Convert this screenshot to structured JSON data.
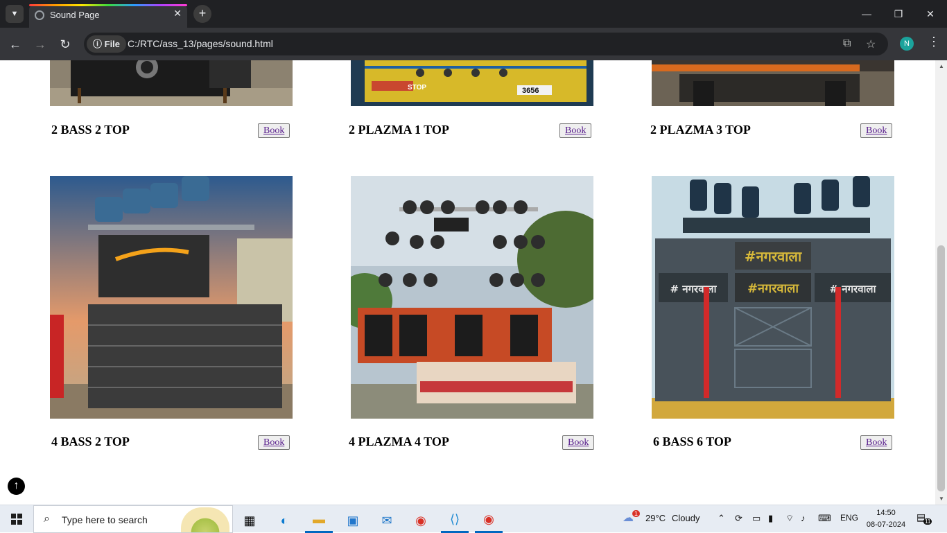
{
  "browser": {
    "tab_title": "Sound Page",
    "tab_close": "✕",
    "new_tab": "+",
    "url_scheme_label": "File",
    "url": "C:/RTC/ass_13/pages/sound.html",
    "profile_initial": "N"
  },
  "cards": [
    {
      "title": "2 BASS 2 TOP",
      "button": "Book"
    },
    {
      "title": "2 PLAZMA 1 TOP",
      "button": "Book"
    },
    {
      "title": "2 PLAZMA 3 TOP",
      "button": "Book"
    },
    {
      "title": "4 BASS 2 TOP",
      "button": "Book"
    },
    {
      "title": "4 PLAZMA 4 TOP",
      "button": "Book"
    },
    {
      "title": "6 BASS 6 TOP",
      "button": "Book"
    }
  ],
  "banners": {
    "banner_5": "#नगरवाला",
    "banner_6_left": "# नगरवाला",
    "banner_6_right": "# नगरवाला",
    "truck_plate": "3656",
    "truck_stop": "STOP"
  },
  "taskbar": {
    "search_placeholder": "Type here to search",
    "weather_temp": "29°C",
    "weather_desc": "Cloudy",
    "language": "ENG",
    "time": "14:50",
    "date": "08-07-2024",
    "notification_count": "11",
    "weather_badge": "1"
  }
}
